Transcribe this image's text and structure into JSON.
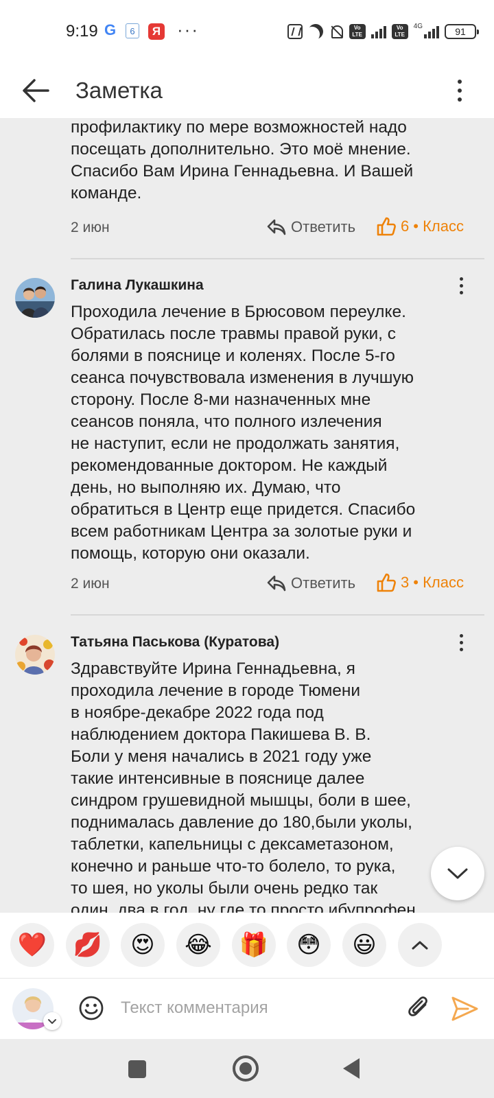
{
  "status_bar": {
    "time": "9:19",
    "google_letter": "G",
    "calendar_day": "6",
    "yandex_letter": "Я",
    "more": "···",
    "volte1": "Vo LTE",
    "volte2": "Vo LTE",
    "network": "4G",
    "battery": "91"
  },
  "header": {
    "title": "Заметка",
    "back_icon": "arrow-left-icon",
    "menu_icon": "more-vertical-icon"
  },
  "comments": [
    {
      "text": "профилактику по мере возможностей надо\nпосещать дополнительно. Это моё мнение.\nСпасибо Вам Ирина Геннадьевна. И Вашей\nкоманде.",
      "date": "2 июн",
      "reply_label": "Ответить",
      "likes": "6",
      "class_label": "• Класс"
    },
    {
      "author": "Галина Лукашкина",
      "text": "Проходила лечение в Брюсовом переулке.\nОбратилась после травмы правой руки, с\nболями в пояснице и коленях. После 5-го\nсеанса почувствовала изменения в лучшую\nсторону. После 8-ми назначенных мне\nсеансов поняла, что полного излечения\nне наступит, если не продолжать занятия,\nрекомендованные доктором. Не каждый\nдень, но выполняю их. Думаю, что\nобратиться в Центр еще придется. Спасибо\nвсем работникам Центра за золотые руки и\nпомощь, которую они оказали.",
      "date": "2 июн",
      "reply_label": "Ответить",
      "likes": "3",
      "class_label": "• Класс"
    },
    {
      "author": "Татьяна Паськова (Куратова)",
      "text": "Здравствуйте Ирина Геннадьевна, я\nпроходила лечение в городе Тюмени\nв ноябре-декабре 2022 года под\nнаблюдением доктора Пакишева В. В.\nБоли у меня начались в 2021 году уже\nтакие интенсивные в пояснице далее\nсиндром грушевидной мышцы, боли в шее,\nподнималась давление до 180,были уколы,\nтаблетки, капельницы с дексаметазоном,\nконечно и раньше что-то болело, то рука,\nто шея, но уколы были очень редко так\nодин, два в год, ну где то просто ибупрофен"
    }
  ],
  "reactions": [
    {
      "emoji": "❤️",
      "name": "heart"
    },
    {
      "emoji": "💋",
      "name": "kiss"
    },
    {
      "emoji": "😍",
      "name": "heart-eyes"
    },
    {
      "emoji": "😂",
      "name": "laughing"
    },
    {
      "emoji": "🎁",
      "name": "gift"
    },
    {
      "emoji": "😳",
      "name": "flushed"
    },
    {
      "emoji": "😃",
      "name": "smile"
    }
  ],
  "compose": {
    "placeholder": "Текст комментария",
    "emoji_icon": "smile-icon",
    "attach_icon": "paperclip-icon",
    "send_icon": "send-icon"
  },
  "colors": {
    "accent": "#ee8208",
    "background": "#ededed",
    "surface": "#ffffff",
    "text": "#1f1f1f",
    "muted": "#555555"
  }
}
